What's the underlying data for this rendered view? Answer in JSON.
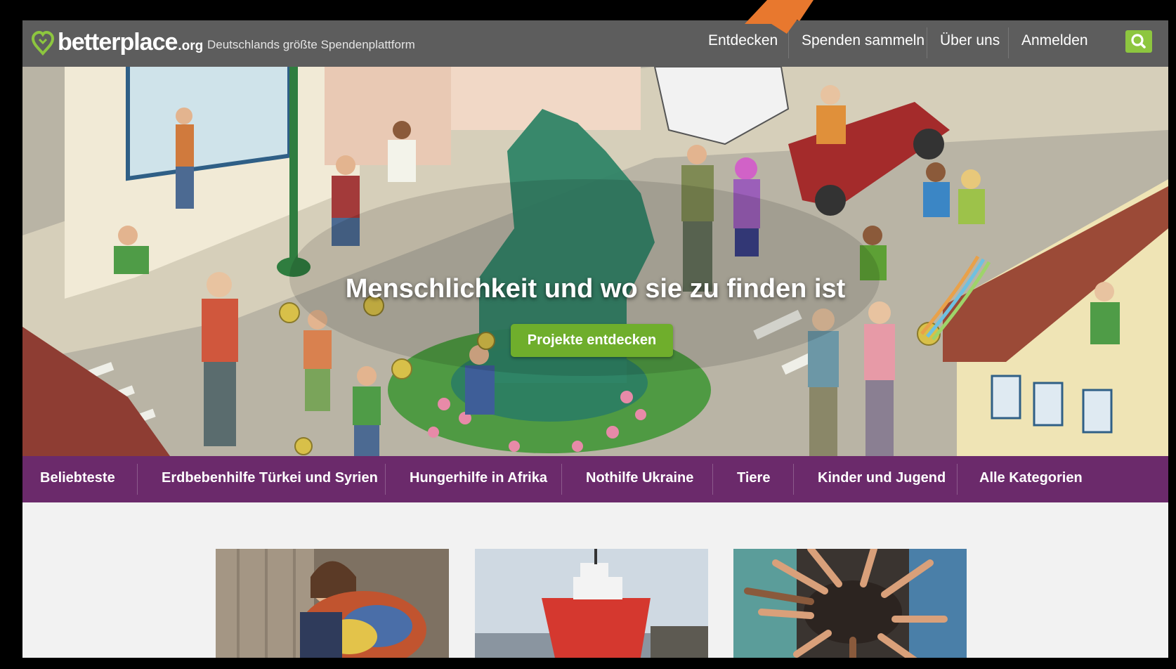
{
  "site": {
    "logo_main": "betterplace",
    "logo_ext": ".org",
    "tagline": "Deutschlands größte Spendenplattform"
  },
  "nav": {
    "items": [
      {
        "label": "Entdecken"
      },
      {
        "label": "Spenden sammeln"
      },
      {
        "label": "Über uns"
      },
      {
        "label": "Anmelden"
      }
    ]
  },
  "hero": {
    "title": "Menschlichkeit und wo sie zu finden ist",
    "button_label": "Projekte entdecken"
  },
  "categories": [
    {
      "label": "Beliebteste"
    },
    {
      "label": "Erdbebenhilfe Türkei und Syrien"
    },
    {
      "label": "Hungerhilfe in Afrika"
    },
    {
      "label": "Nothilfe Ukraine"
    },
    {
      "label": "Tiere"
    },
    {
      "label": "Kinder und Jugend"
    },
    {
      "label": "Alle Kategorien"
    }
  ],
  "colors": {
    "nav_bg": "#5d5d5d",
    "brand_green": "#8dc63f",
    "button_green": "#6fae2c",
    "category_purple": "#6b2a6b",
    "annotation_arrow": "#e8782e"
  },
  "icons": {
    "logo": "heart-location-icon",
    "search": "search-icon",
    "arrow": "pointer-arrow-annotation"
  }
}
